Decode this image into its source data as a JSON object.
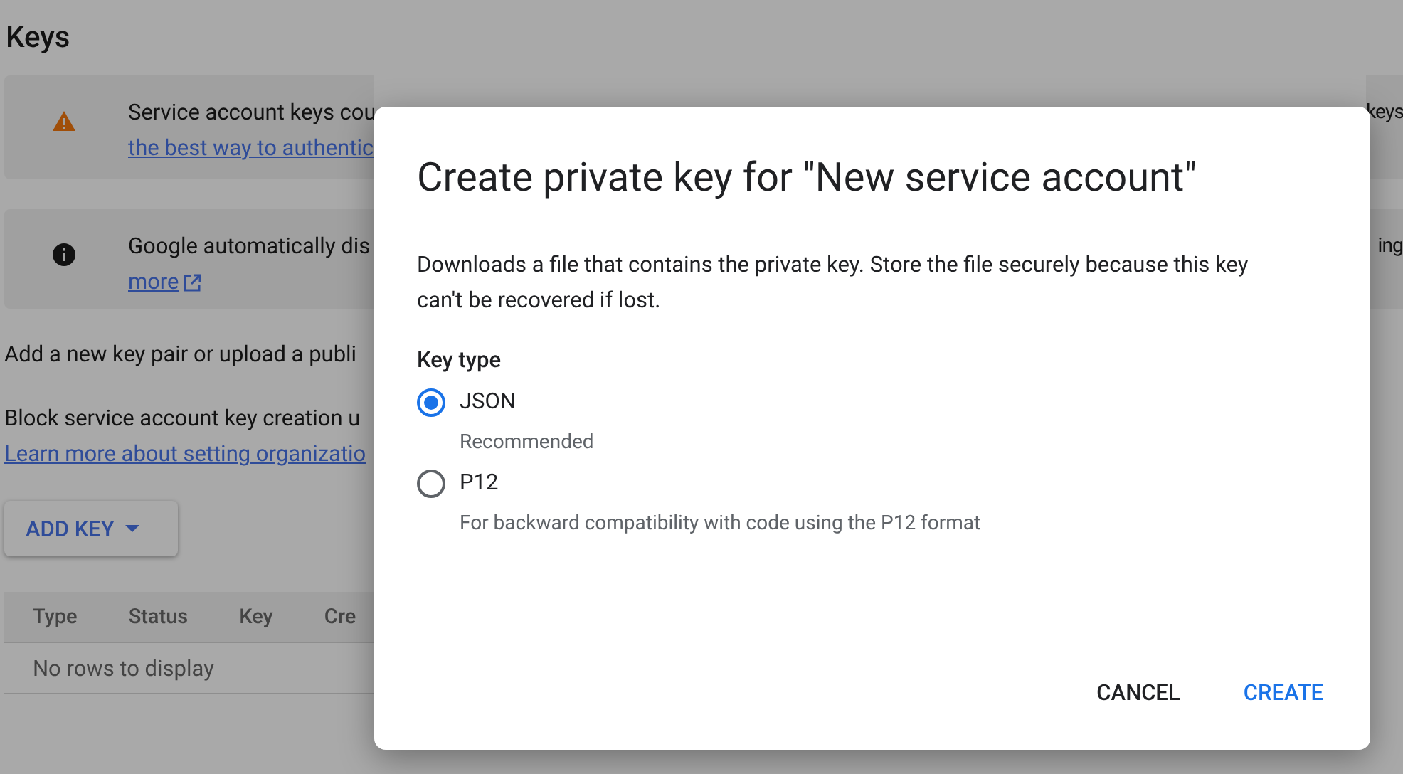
{
  "page": {
    "title": "Keys",
    "banners": [
      {
        "kind": "warning",
        "text": "Service account keys cou",
        "link": "the best way to authentic",
        "external": false,
        "overflow_text": "keys"
      },
      {
        "kind": "info",
        "text": "Google automatically dis",
        "link": "more",
        "external": true,
        "overflow_text": "ing"
      }
    ],
    "add_text": "Add a new key pair or upload a publi",
    "block_text": "Block service account key creation u",
    "block_link": "Learn more about setting organizatio",
    "add_button": "ADD KEY",
    "table": {
      "columns": [
        "Type",
        "Status",
        "Key",
        "Cre"
      ],
      "empty": "No rows to display"
    }
  },
  "dialog": {
    "title": "Create private key for \"New service account\"",
    "description": "Downloads a file that contains the private key. Store the file securely because this key can't be recovered if lost.",
    "group_label": "Key type",
    "options": [
      {
        "label": "JSON",
        "hint": "Recommended",
        "selected": true
      },
      {
        "label": "P12",
        "hint": "For backward compatibility with code using the P12 format",
        "selected": false
      }
    ],
    "buttons": [
      {
        "label": "CANCEL",
        "kind": "secondary"
      },
      {
        "label": "CREATE",
        "kind": "primary"
      }
    ]
  }
}
